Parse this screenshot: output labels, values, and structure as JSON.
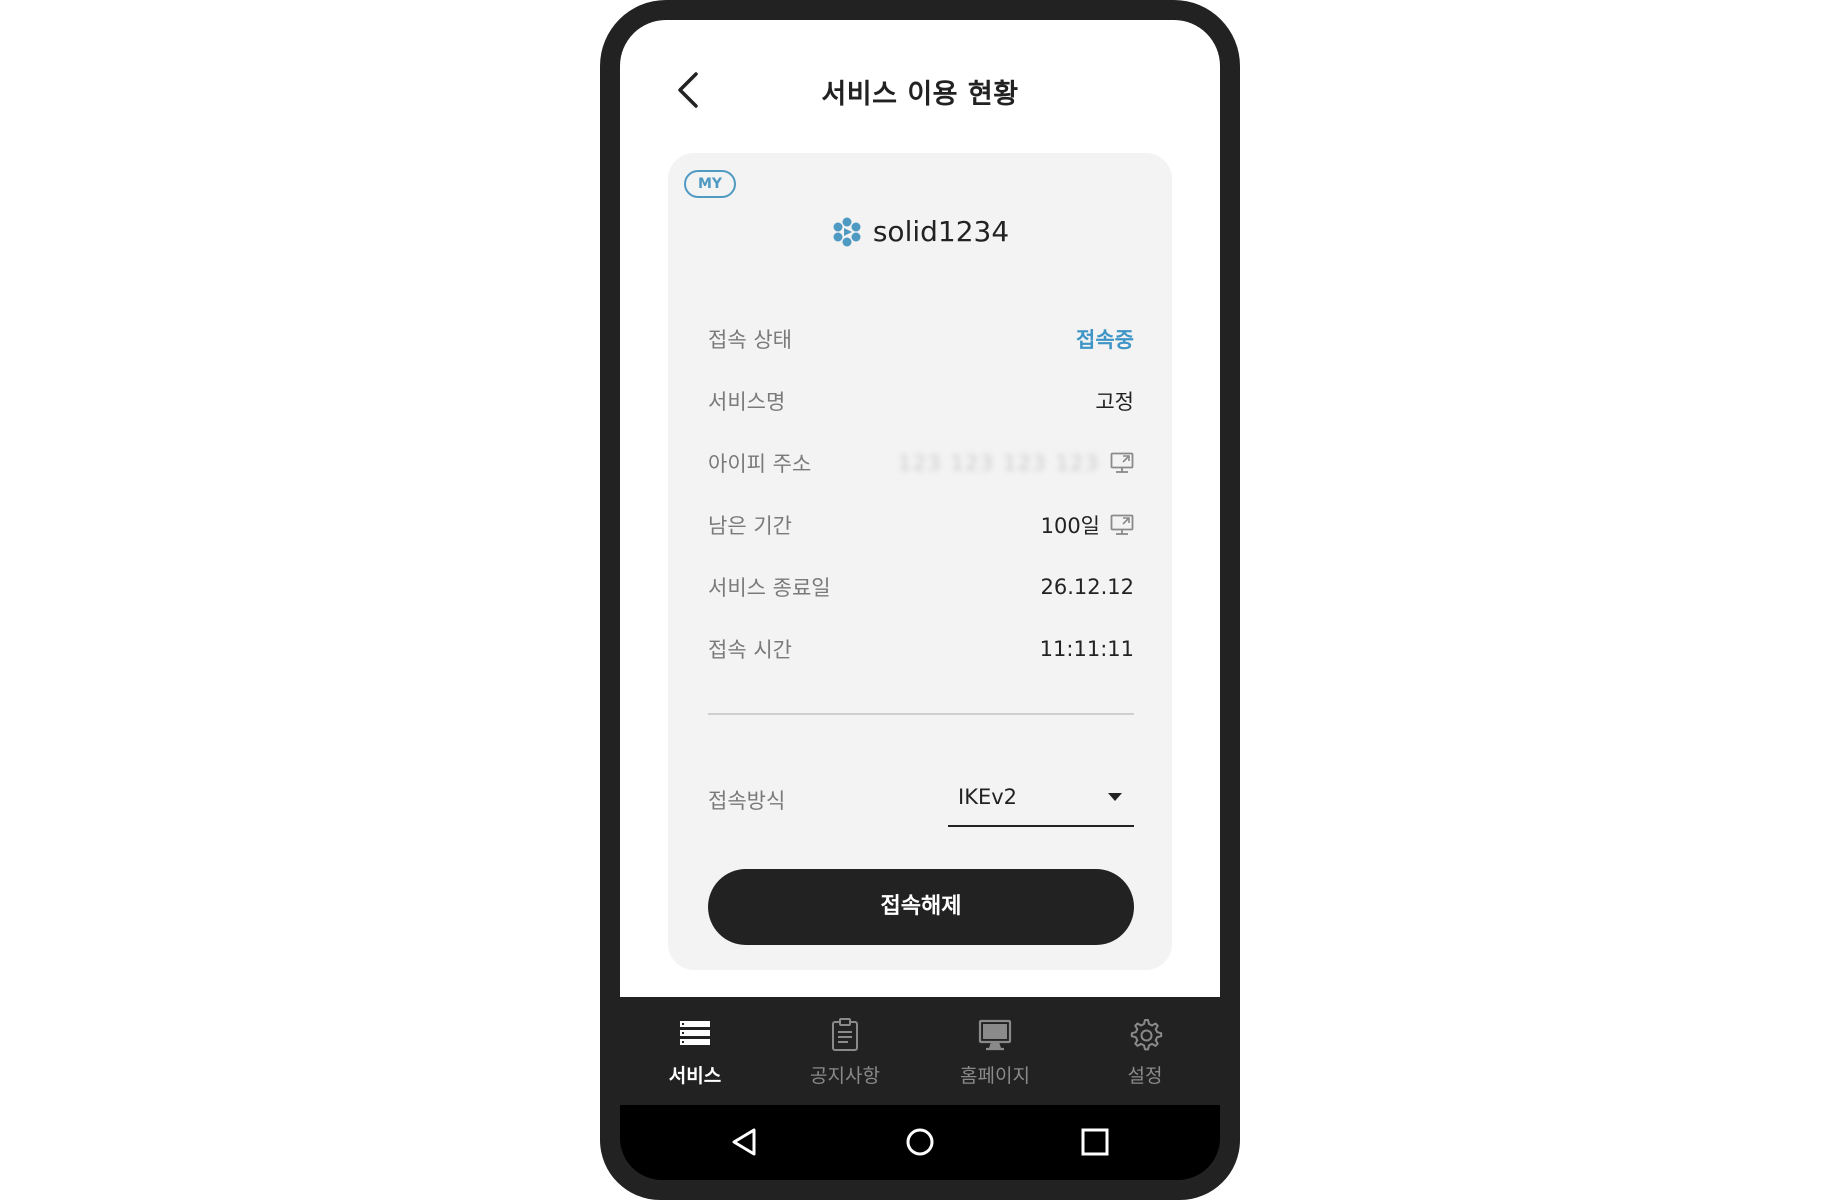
{
  "header": {
    "title": "서비스 이용 현황"
  },
  "card": {
    "badge": "MY",
    "account_name": "solid1234",
    "rows": [
      {
        "label": "접속 상태",
        "value": "접속중"
      },
      {
        "label": "서비스명",
        "value": "고정"
      },
      {
        "label": "아이피 주소",
        "value": "123 123 123 123"
      },
      {
        "label": "남은 기간",
        "value": "100일"
      },
      {
        "label": "서비스 종료일",
        "value": "26.12.12"
      },
      {
        "label": "접속 시간",
        "value": "11:11:11"
      }
    ],
    "method_label": "접속방식",
    "method_value": "IKEv2",
    "disconnect_label": "접속해제"
  },
  "nav": {
    "items": [
      {
        "label": "서비스",
        "icon": "list-icon",
        "active": true
      },
      {
        "label": "공지사항",
        "icon": "clipboard-icon",
        "active": false
      },
      {
        "label": "홈페이지",
        "icon": "monitor-icon",
        "active": false
      },
      {
        "label": "설정",
        "icon": "gear-icon",
        "active": false
      }
    ]
  },
  "colors": {
    "accent": "#3f95c6",
    "dark": "#222222",
    "card_bg": "#f3f3f3"
  }
}
